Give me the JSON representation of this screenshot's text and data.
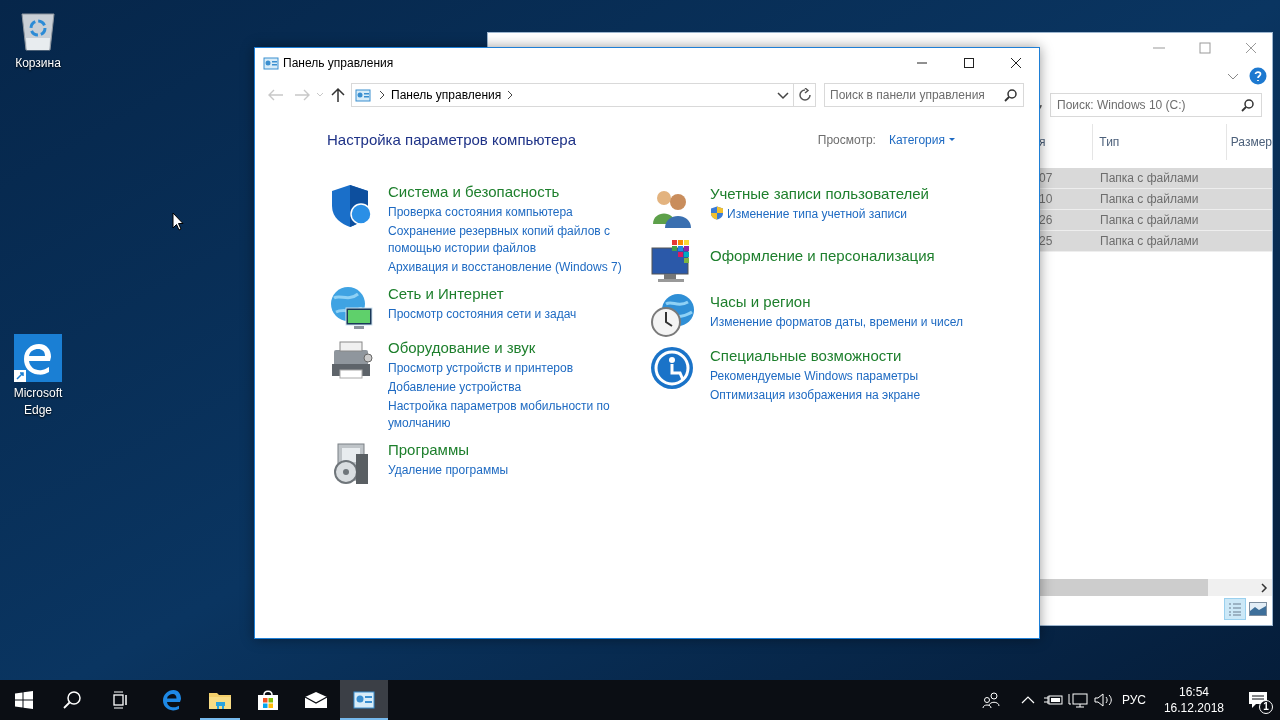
{
  "desktop_icons": [
    {
      "kind": "recycle",
      "label": "Корзина"
    },
    {
      "kind": "edge",
      "label": "Microsoft Edge"
    }
  ],
  "explorer_window": {
    "search": {
      "placeholder": "Поиск: Windows 10 (C:)"
    },
    "columns": [
      "я",
      "Тип",
      "Размер"
    ],
    "rows": [
      {
        "column_1": "07",
        "type": "Папка с файлами",
        "selected": true
      },
      {
        "column_1": "10",
        "type": "Папка с файлами",
        "selected": true
      },
      {
        "column_1": "26",
        "type": "Папка с файлами",
        "selected": true
      },
      {
        "column_1": "25",
        "type": "Папка с файлами",
        "selected": true
      }
    ]
  },
  "control_panel": {
    "title": "Панель управления",
    "address": "Панель управления",
    "search": {
      "placeholder": "Поиск в панели управления"
    },
    "heading": "Настройка параметров компьютера",
    "view_label": "Просмотр:",
    "view_value": "Категория",
    "left_categories": [
      {
        "kind": "security",
        "title": "Система и безопасность",
        "links": [
          {
            "text": "Проверка состояния компьютера",
            "shield": false
          },
          {
            "text": "Сохранение резервных копий файлов с помощью истории файлов",
            "shield": false
          },
          {
            "text": "Архивация и восстановление (Windows 7)",
            "shield": false
          }
        ]
      },
      {
        "kind": "network",
        "title": "Сеть и Интернет",
        "links": [
          {
            "text": "Просмотр состояния сети и задач",
            "shield": false
          }
        ]
      },
      {
        "kind": "hardware",
        "title": "Оборудование и звук",
        "links": [
          {
            "text": "Просмотр устройств и принтеров",
            "shield": false
          },
          {
            "text": "Добавление устройства",
            "shield": false
          },
          {
            "text": "Настройка параметров мобильности по умолчанию",
            "shield": false
          }
        ]
      },
      {
        "kind": "programs",
        "title": "Программы",
        "links": [
          {
            "text": "Удаление программы",
            "shield": false
          }
        ]
      }
    ],
    "right_categories": [
      {
        "kind": "users",
        "title": "Учетные записи пользователей",
        "links": [
          {
            "text": "Изменение типа учетной записи",
            "shield": true
          }
        ]
      },
      {
        "kind": "appearance",
        "title": "Оформление и персонализация"
      },
      {
        "kind": "clock",
        "title": "Часы и регион",
        "links": [
          {
            "text": "Изменение форматов даты, времени и чисел",
            "shield": false
          }
        ]
      },
      {
        "kind": "access",
        "title": "Специальные возможности",
        "links": [
          {
            "text": "Рекомендуемые Windows параметры",
            "shield": false
          },
          {
            "text": "Оптимизация изображения на экране",
            "shield": false
          }
        ]
      }
    ]
  },
  "taskbar": {
    "items": [
      {
        "kind": "start",
        "running": false,
        "selected": false
      },
      {
        "kind": "search",
        "running": false,
        "selected": false
      },
      {
        "kind": "taskview",
        "running": false,
        "selected": false
      },
      {
        "kind": "edge",
        "running": false,
        "selected": false
      },
      {
        "kind": "explorer",
        "running": true,
        "selected": false
      },
      {
        "kind": "store",
        "running": false,
        "selected": false
      },
      {
        "kind": "mail",
        "running": false,
        "selected": false
      },
      {
        "kind": "controlpanel",
        "running": true,
        "selected": true
      }
    ],
    "language": "РУС",
    "time": "16:54",
    "date": "16.12.2018",
    "notification_count": "1"
  }
}
